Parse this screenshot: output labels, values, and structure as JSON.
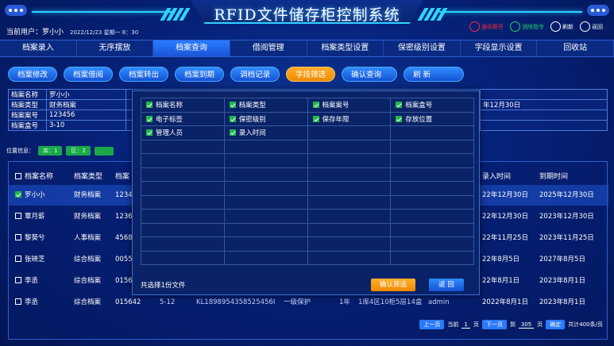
{
  "window": {
    "title": "RFID文件储存柜控制系统"
  },
  "user": {
    "label": "当前用户：罗小小",
    "datetime": "2022/12/23  星期一  8：30"
  },
  "header_actions": [
    {
      "label": "通讯断开",
      "icon": "wifi-icon",
      "color": "#ff2a3c"
    },
    {
      "label": "消除指令",
      "icon": "check-circle-icon",
      "color": "#23d46b"
    },
    {
      "label": "刷新",
      "icon": "refresh-icon",
      "color": "#ffffff"
    },
    {
      "label": "返回",
      "icon": "back-icon",
      "color": "#ffffff"
    }
  ],
  "nav": [
    "档案录入",
    "无序摆放",
    "档案查询",
    "借阅管理",
    "档案类型设置",
    "保密级别设置",
    "字段显示设置",
    "回收站"
  ],
  "nav_active": "档案查询",
  "toolbar": [
    "档案修改",
    "档案借阅",
    "档案转出",
    "档案到期",
    "调档记录",
    "字段筛选",
    "确认查询",
    "刷  新"
  ],
  "toolbar_active": "字段筛选",
  "detail": {
    "rows": [
      {
        "k": "档案名称",
        "v": "罗小小"
      },
      {
        "k": "档案类型",
        "v": "财务档案"
      },
      {
        "k": "档案案号",
        "v": "123456"
      },
      {
        "k": "档案盒号",
        "v": "3-10"
      }
    ],
    "right_fragment": "年12月30日"
  },
  "position": {
    "label": "位置信息：",
    "tags": [
      "库：1",
      "区：2",
      ""
    ]
  },
  "list": {
    "headers": {
      "name": "档案名称",
      "type": "档案类型",
      "code": "档案",
      "entry": "录入时间",
      "expire": "到期时间"
    },
    "rows": [
      {
        "checked": true,
        "name": "罗小小",
        "type": "财务档案",
        "code": "1234",
        "entry": "22年12月30日",
        "expire": "2025年12月30日"
      },
      {
        "checked": false,
        "name": "覃月薪",
        "type": "财务档案",
        "code": "1236",
        "entry": "22年12月30日",
        "expire": "2023年12月30日"
      },
      {
        "checked": false,
        "name": "黎葵兮",
        "type": "人事档案",
        "code": "4568",
        "entry": "22年11月25日",
        "expire": "2023年11月25日"
      },
      {
        "checked": false,
        "name": "张晓芝",
        "type": "综合档案",
        "code": "0055",
        "entry": "22年8月5日",
        "expire": "2027年8月5日"
      },
      {
        "checked": false,
        "name": "李丞",
        "type": "综合档案",
        "code": "0156",
        "entry": "22年8月1日",
        "expire": "2023年8月1日"
      },
      {
        "checked": false,
        "name": "李丞",
        "type": "综合档案",
        "code": "015642",
        "extra": [
          "5-12",
          "KL1898954358525456I",
          "一级保护",
          "1年",
          "1库4区10柜5层14盒",
          "admin"
        ],
        "entry": "2022年8月1日",
        "expire": "2023年8月1日"
      }
    ]
  },
  "pager": {
    "prev": "上一页",
    "current_label": "当前",
    "current": "1",
    "page_unit": "页",
    "next": "下一页",
    "goto_label": "到",
    "goto": "305",
    "confirm": "确定",
    "total": "共计400条/页"
  },
  "modal": {
    "fields": [
      {
        "label": "档案名称",
        "checked": true
      },
      {
        "label": "档案类型",
        "checked": true
      },
      {
        "label": "档案案号",
        "checked": true
      },
      {
        "label": "档案盒号",
        "checked": true
      },
      {
        "label": "电子标签",
        "checked": true
      },
      {
        "label": "保密级别",
        "checked": true
      },
      {
        "label": "保存年限",
        "checked": true
      },
      {
        "label": "存放位置",
        "checked": true
      },
      {
        "label": "管理人员",
        "checked": true
      },
      {
        "label": "录入时间",
        "checked": true
      }
    ],
    "footer_text": "共选择1份文件",
    "confirm": "确认筛选",
    "back": "返  回"
  },
  "colors": {
    "accent": "#2fd3ff",
    "orange": "#f5961a",
    "green": "#20b84e",
    "nav_active": "#2a7bff"
  }
}
